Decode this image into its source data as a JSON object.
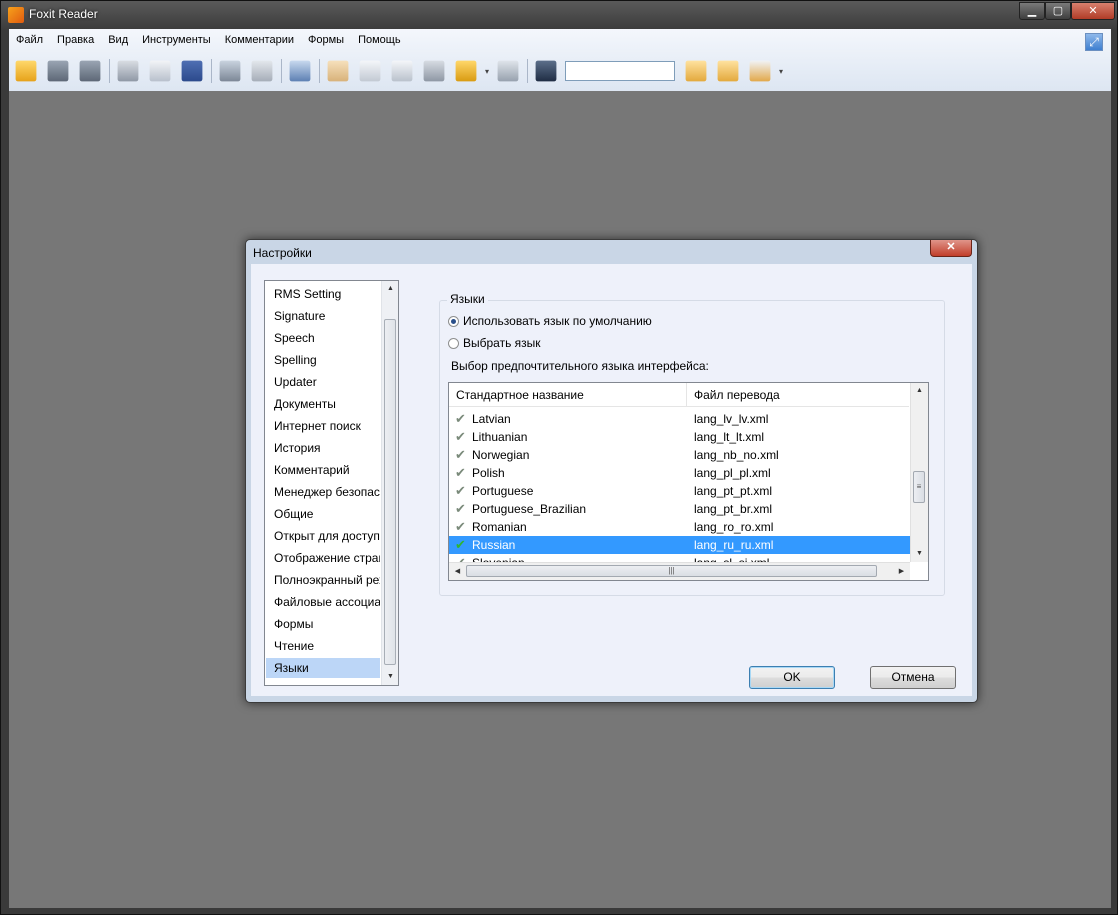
{
  "app": {
    "title": "Foxit Reader",
    "expand_glyph": "⤢",
    "min_glyph": "▁",
    "max_glyph": "▢",
    "close_glyph": "✕"
  },
  "menu": [
    "Файл",
    "Правка",
    "Вид",
    "Инструменты",
    "Комментарии",
    "Формы",
    "Помощь"
  ],
  "toolbar": {
    "icons": [
      "open-folder-icon",
      "save-icon",
      "save-as-icon",
      "print-icon",
      "email-icon",
      "facebook-icon",
      "fullscreen-icon",
      "spellcheck-icon",
      "snapshot-icon",
      "hand-tool-icon",
      "select-tool-icon",
      "text-select-icon",
      "snapshot-camera-icon",
      "rms-lock-icon",
      "signature-pen-icon",
      "find-binoculars-icon",
      "find-prev-icon",
      "find-next-icon",
      "search-options-icon"
    ],
    "search_value": ""
  },
  "dialog": {
    "title": "Настройки",
    "close_glyph": "✕",
    "categories": [
      "RMS Setting",
      "Signature",
      "Speech",
      "Spelling",
      "Updater",
      "Документы",
      "Интернет поиск",
      "История",
      "Комментарий",
      "Менеджер безопасности",
      "Общие",
      "Открыт для доступа",
      "Отображение страницы",
      "Полноэкранный режим",
      "Файловые ассоциации",
      "Формы",
      "Чтение",
      "Языки"
    ],
    "selected_category": "Языки",
    "group_label": "Языки",
    "radio_default": "Использовать язык по умолчанию",
    "radio_choose": "Выбрать язык",
    "prompt": "Выбор предпочтительного языка интерфейса:",
    "table": {
      "col1": "Стандартное название",
      "col2": "Файл перевода",
      "rows": [
        {
          "name": "Latvian",
          "file": "lang_lv_lv.xml"
        },
        {
          "name": "Lithuanian",
          "file": "lang_lt_lt.xml"
        },
        {
          "name": "Norwegian",
          "file": "lang_nb_no.xml"
        },
        {
          "name": "Polish",
          "file": "lang_pl_pl.xml"
        },
        {
          "name": "Portuguese",
          "file": "lang_pt_pt.xml"
        },
        {
          "name": "Portuguese_Brazilian",
          "file": "lang_pt_br.xml"
        },
        {
          "name": "Romanian",
          "file": "lang_ro_ro.xml"
        },
        {
          "name": "Russian",
          "file": "lang_ru_ru.xml"
        },
        {
          "name": "Slovenian",
          "file": "lang_sl_si.xml"
        }
      ],
      "selected": "Russian",
      "check_glyph": "✔"
    },
    "ok_label": "OK",
    "cancel_label": "Отмена"
  }
}
